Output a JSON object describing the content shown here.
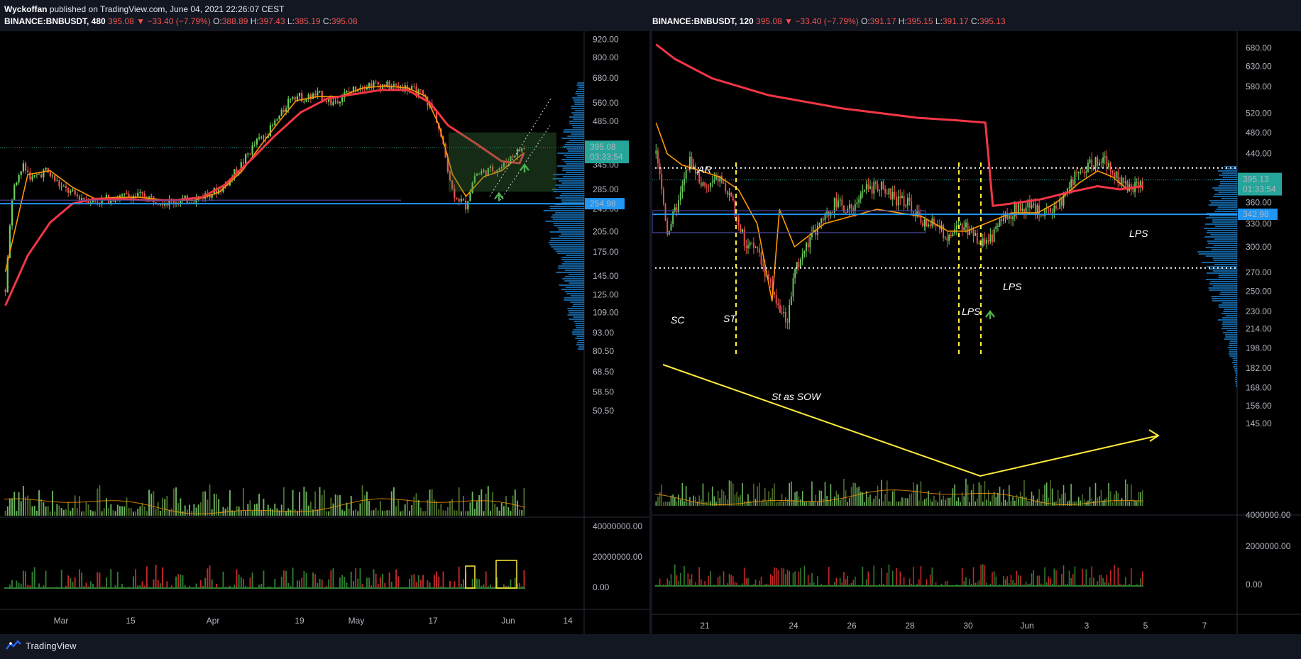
{
  "header": {
    "author": "Wyckoffan",
    "published_text": "published on TradingView.com, June 04, 2021 22:26:07 CEST"
  },
  "footer": {
    "brand": "TradingView"
  },
  "colors": {
    "up": "#6fcf5e",
    "down": "#ef5350",
    "vol_up": "#77c96a",
    "vol_down": "#c62828",
    "ma_fast": "#ff9800",
    "ma_slow": "#f23645",
    "support": "#2196f3",
    "annot": "#ffeb3b",
    "price_tag": "#26a69a"
  },
  "chart_data": [
    {
      "type": "candlestick",
      "symbol": "BINANCE:BNBUSDT",
      "interval": "480",
      "last": "395.08",
      "change": "−33.40 (−7.79%)",
      "ohlc": {
        "O": "388.89",
        "H": "397.43",
        "L": "385.19",
        "C": "395.08"
      },
      "y_scale": "log",
      "y_ticks": [
        "920.00",
        "800.00",
        "680.00",
        "560.00",
        "485.00",
        "395.08",
        "345.00",
        "285.00",
        "254.98",
        "245.00",
        "205.00",
        "175.00",
        "145.00",
        "125.00",
        "109.00",
        "93.00",
        "80.50",
        "68.50",
        "58.50",
        "50.50"
      ],
      "x_ticks": [
        "Mar",
        "15",
        "Apr",
        "19",
        "May",
        "17",
        "Jun",
        "14"
      ],
      "last_price_tag": "395.08",
      "countdown": "03:33:54",
      "support_level": "254.98",
      "price_path": [
        [
          0,
          130
        ],
        [
          4,
          300
        ],
        [
          8,
          340
        ],
        [
          12,
          310
        ],
        [
          18,
          330
        ],
        [
          25,
          290
        ],
        [
          32,
          270
        ],
        [
          40,
          260
        ],
        [
          50,
          268
        ],
        [
          60,
          272
        ],
        [
          72,
          258
        ],
        [
          85,
          265
        ],
        [
          96,
          285
        ],
        [
          100,
          305
        ],
        [
          106,
          350
        ],
        [
          112,
          410
        ],
        [
          118,
          450
        ],
        [
          124,
          520
        ],
        [
          128,
          600
        ],
        [
          134,
          580
        ],
        [
          140,
          600
        ],
        [
          146,
          560
        ],
        [
          152,
          600
        ],
        [
          158,
          640
        ],
        [
          164,
          650
        ],
        [
          172,
          640
        ],
        [
          180,
          630
        ],
        [
          186,
          600
        ],
        [
          192,
          520
        ],
        [
          196,
          390
        ],
        [
          200,
          280
        ],
        [
          206,
          250
        ],
        [
          210,
          320
        ],
        [
          216,
          330
        ],
        [
          222,
          340
        ],
        [
          228,
          380
        ],
        [
          232,
          395
        ]
      ],
      "ma_fast_path": [
        [
          0,
          150
        ],
        [
          10,
          320
        ],
        [
          20,
          330
        ],
        [
          30,
          290
        ],
        [
          40,
          265
        ],
        [
          50,
          268
        ],
        [
          60,
          268
        ],
        [
          72,
          262
        ],
        [
          85,
          262
        ],
        [
          96,
          280
        ],
        [
          106,
          330
        ],
        [
          114,
          400
        ],
        [
          122,
          480
        ],
        [
          130,
          570
        ],
        [
          140,
          590
        ],
        [
          150,
          590
        ],
        [
          160,
          630
        ],
        [
          170,
          640
        ],
        [
          180,
          630
        ],
        [
          188,
          590
        ],
        [
          194,
          470
        ],
        [
          200,
          320
        ],
        [
          206,
          270
        ],
        [
          214,
          315
        ],
        [
          222,
          330
        ],
        [
          232,
          380
        ]
      ],
      "ma_slow_path": [
        [
          0,
          115
        ],
        [
          10,
          170
        ],
        [
          20,
          220
        ],
        [
          30,
          255
        ],
        [
          40,
          265
        ],
        [
          52,
          265
        ],
        [
          64,
          262
        ],
        [
          76,
          262
        ],
        [
          88,
          268
        ],
        [
          98,
          295
        ],
        [
          110,
          360
        ],
        [
          120,
          430
        ],
        [
          132,
          520
        ],
        [
          144,
          580
        ],
        [
          156,
          600
        ],
        [
          168,
          620
        ],
        [
          180,
          620
        ],
        [
          190,
          560
        ],
        [
          198,
          470
        ],
        [
          210,
          410
        ],
        [
          222,
          355
        ],
        [
          230,
          350
        ],
        [
          232,
          380
        ]
      ],
      "volume_sma_ticks": [],
      "osc_ticks": [
        "40000000.00",
        "20000000.00",
        "0.00"
      ]
    },
    {
      "type": "candlestick",
      "symbol": "BINANCE:BNBUSDT",
      "interval": "120",
      "last": "395.08",
      "change": "−33.40 (−7.79%)",
      "ohlc": {
        "O": "391.17",
        "H": "395.15",
        "L": "391.17",
        "C": "395.13"
      },
      "y_scale": "log",
      "y_ticks": [
        "680.00",
        "630.00",
        "580.00",
        "520.00",
        "480.00",
        "440.00",
        "395.13",
        "360.00",
        "342.98",
        "330.00",
        "300.00",
        "270.00",
        "250.00",
        "230.00",
        "214.00",
        "198.00",
        "182.00",
        "168.00",
        "156.00",
        "145.00"
      ],
      "x_ticks": [
        "21",
        "24",
        "26",
        "28",
        "30",
        "Jun",
        "3",
        "5",
        "7"
      ],
      "last_price_tag": "395.13",
      "countdown": "01:33:54",
      "support_level": "342.98",
      "resistance_dotted": "415.00",
      "support_dotted": "275.00",
      "annotations": [
        "AR",
        "SC",
        "ST",
        "St as SOW",
        "LPS",
        "LPS",
        "LPS"
      ],
      "osc_ticks": [
        "4000000.00",
        "2000000.00",
        "0.00"
      ]
    }
  ]
}
